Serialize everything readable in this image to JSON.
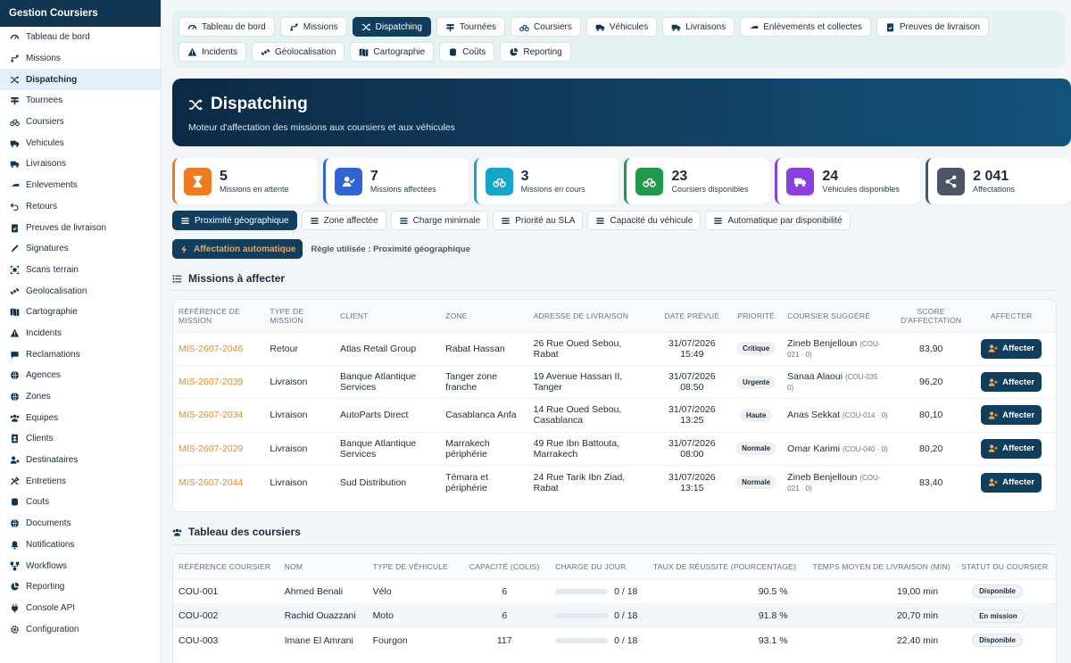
{
  "app": {
    "title": "Gestion Coursiers"
  },
  "sidebar": {
    "items": [
      {
        "label": "Tableau de bord",
        "icon": "dashboard-icon"
      },
      {
        "label": "Missions",
        "icon": "route-icon"
      },
      {
        "label": "Dispatching",
        "icon": "shuffle-icon",
        "active": true
      },
      {
        "label": "Tournees",
        "icon": "signs-icon"
      },
      {
        "label": "Coursiers",
        "icon": "bicycle-icon"
      },
      {
        "label": "Vehicules",
        "icon": "truck-icon"
      },
      {
        "label": "Livraisons",
        "icon": "delivery-truck-icon"
      },
      {
        "label": "Enlevements",
        "icon": "pickup-icon"
      },
      {
        "label": "Retours",
        "icon": "return-icon"
      },
      {
        "label": "Preuves de livraison",
        "icon": "clipboard-check-icon"
      },
      {
        "label": "Signatures",
        "icon": "signature-icon"
      },
      {
        "label": "Scans terrain",
        "icon": "scan-icon"
      },
      {
        "label": "Geolocalisation",
        "icon": "satellite-icon"
      },
      {
        "label": "Cartographie",
        "icon": "map-icon"
      },
      {
        "label": "Incidents",
        "icon": "warning-icon"
      },
      {
        "label": "Reclamations",
        "icon": "chat-icon"
      },
      {
        "label": "Agences",
        "icon": "globe-icon"
      },
      {
        "label": "Zones",
        "icon": "globe-alt-icon"
      },
      {
        "label": "Equipes",
        "icon": "users-icon"
      },
      {
        "label": "Clients",
        "icon": "address-book-icon"
      },
      {
        "label": "Destinataires",
        "icon": "user-tag-icon"
      },
      {
        "label": "Entretiens",
        "icon": "tools-icon"
      },
      {
        "label": "Couts",
        "icon": "coins-icon"
      },
      {
        "label": "Documents",
        "icon": "globe-doc-icon"
      },
      {
        "label": "Notifications",
        "icon": "bell-icon"
      },
      {
        "label": "Workflows",
        "icon": "workflow-icon"
      },
      {
        "label": "Reporting",
        "icon": "pie-chart-icon"
      },
      {
        "label": "Console API",
        "icon": "plug-icon"
      },
      {
        "label": "Configuration",
        "icon": "cog-icon"
      }
    ]
  },
  "topnav": {
    "tabs": [
      {
        "label": "Tableau de bord",
        "icon": "dashboard-icon"
      },
      {
        "label": "Missions",
        "icon": "route-icon"
      },
      {
        "label": "Dispatching",
        "icon": "shuffle-icon",
        "active": true
      },
      {
        "label": "Tournées",
        "icon": "signs-icon"
      },
      {
        "label": "Coursiers",
        "icon": "bicycle-icon"
      },
      {
        "label": "Véhicules",
        "icon": "truck-icon"
      },
      {
        "label": "Livraisons",
        "icon": "delivery-truck-icon"
      },
      {
        "label": "Enlèvements et collectes",
        "icon": "pickup-icon"
      },
      {
        "label": "Preuves de livraison",
        "icon": "clipboard-check-icon"
      },
      {
        "label": "Incidents",
        "icon": "warning-icon"
      },
      {
        "label": "Géolocalisation",
        "icon": "satellite-icon"
      },
      {
        "label": "Cartographie",
        "icon": "map-icon"
      },
      {
        "label": "Coûts",
        "icon": "coins-icon"
      },
      {
        "label": "Reporting",
        "icon": "pie-chart-icon"
      }
    ]
  },
  "hero": {
    "title": "Dispatching",
    "subtitle": "Moteur d'affectation des missions aux coursiers et aux véhicules"
  },
  "kpis": [
    {
      "value": "5",
      "label": "Missions en attente",
      "color": "#f07a1e",
      "icon": "hourglass-icon"
    },
    {
      "value": "7",
      "label": "Missions affectées",
      "color": "#2f63d6",
      "icon": "user-check-icon"
    },
    {
      "value": "3",
      "label": "Missions en cours",
      "color": "#12a7c9",
      "icon": "bicycle-icon"
    },
    {
      "value": "23",
      "label": "Coursiers disponibles",
      "color": "#1f9a4a",
      "icon": "bicycle-icon"
    },
    {
      "value": "24",
      "label": "Véhicules disponibles",
      "color": "#8a3fe0",
      "icon": "truck-icon"
    },
    {
      "value": "2 041",
      "label": "Affectations",
      "color": "#4b5565",
      "icon": "share-icon"
    }
  ],
  "rules": [
    {
      "label": "Proximité géographique",
      "active": true
    },
    {
      "label": "Zone affectée"
    },
    {
      "label": "Charge minimale"
    },
    {
      "label": "Priorité au SLA"
    },
    {
      "label": "Capacité du véhicule"
    },
    {
      "label": "Automatique par disponibilité"
    }
  ],
  "auto": {
    "button": "Affectation automatique",
    "rule_used": "Règle utilisée : Proximité géographique"
  },
  "missions": {
    "title": "Missions à affecter",
    "columns": [
      "Référence de mission",
      "Type de mission",
      "Client",
      "Zone",
      "Adresse de livraison",
      "Date prévue",
      "Priorité",
      "Coursier suggéré",
      "Score d'affectation",
      "Affecter"
    ],
    "action_label": "Affecter",
    "rows": [
      {
        "ref": "MIS-2607-2046",
        "type": "Retour",
        "client": "Atlas Retail Group",
        "zone": "Rabat Hassan",
        "address": "26 Rue Oued Sebou, Rabat",
        "date": "31/07/2026",
        "time": "15:49",
        "priority": "Critique",
        "courier": "Zineb Benjelloun",
        "courier_code": "(COU-021 · 0)",
        "score": "83,90"
      },
      {
        "ref": "MIS-2607-2039",
        "type": "Livraison",
        "client": "Banque Atlantique Services",
        "zone": "Tanger zone franche",
        "address": "19 Avenue Hassan II, Tanger",
        "date": "31/07/2026",
        "time": "08:50",
        "priority": "Urgente",
        "courier": "Sanaa Alaoui",
        "courier_code": "(COU-035 · 0)",
        "score": "96,20"
      },
      {
        "ref": "MIS-2607-2034",
        "type": "Livraison",
        "client": "AutoParts Direct",
        "zone": "Casablanca Anfa",
        "address": "14 Rue Oued Sebou, Casablanca",
        "date": "31/07/2026",
        "time": "13:25",
        "priority": "Haute",
        "courier": "Anas Sekkat",
        "courier_code": "(COU-014 · 0)",
        "score": "80,10"
      },
      {
        "ref": "MIS-2607-2029",
        "type": "Livraison",
        "client": "Banque Atlantique Services",
        "zone": "Marrakech périphérie",
        "address": "49 Rue Ibn Battouta, Marrakech",
        "date": "31/07/2026",
        "time": "08:00",
        "priority": "Normale",
        "courier": "Omar Karimi",
        "courier_code": "(COU-040 · 0)",
        "score": "80,20"
      },
      {
        "ref": "MIS-2607-2044",
        "type": "Livraison",
        "client": "Sud Distribution",
        "zone": "Témara et périphérie",
        "address": "24 Rue Tarik Ibn Ziad, Rabat",
        "date": "31/07/2026",
        "time": "13:15",
        "priority": "Normale",
        "courier": "Zineb Benjelloun",
        "courier_code": "(COU-021 · 0)",
        "score": "83,40"
      }
    ]
  },
  "couriers": {
    "title": "Tableau des coursiers",
    "columns": [
      "Référence coursier",
      "Nom",
      "Type de véhicule",
      "Capacité (colis)",
      "Charge du jour",
      "Taux de réussite (pourcentage)",
      "Temps moyen de livraison (min)",
      "Statut du coursier"
    ],
    "rows": [
      {
        "ref": "COU-001",
        "name": "Ahmed Benali",
        "vehicle": "Vélo",
        "capacity": "6",
        "load": "0 / 18",
        "load_fraction": 0,
        "success": "90.5 %",
        "avg_time": "19,00 min",
        "status": "Disponible"
      },
      {
        "ref": "COU-002",
        "name": "Rachid Ouazzani",
        "vehicle": "Moto",
        "capacity": "6",
        "load": "0 / 18",
        "load_fraction": 0,
        "success": "91.8 %",
        "avg_time": "20,70 min",
        "status": "En mission"
      },
      {
        "ref": "COU-003",
        "name": "Imane El Amrani",
        "vehicle": "Fourgon",
        "capacity": "117",
        "load": "0 / 18",
        "load_fraction": 0,
        "success": "93.1 %",
        "avg_time": "22,40 min",
        "status": "Disponible"
      }
    ]
  }
}
